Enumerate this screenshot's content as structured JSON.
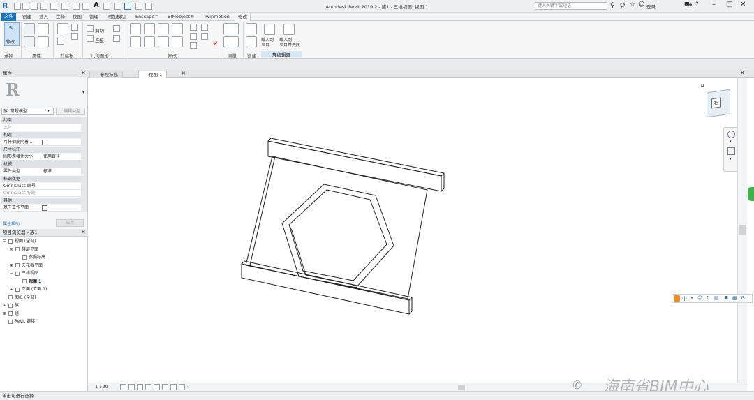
{
  "app": {
    "title": "Autodesk Revit 2019.2 - 族1 - 三维视图: 视图 1",
    "search_placeholder": "键入关键字或短语",
    "signin": "登录",
    "logo": "R"
  },
  "ribbon_tabs": [
    {
      "label": "文件",
      "kind": "file"
    },
    {
      "label": "创建"
    },
    {
      "label": "插入"
    },
    {
      "label": "注释"
    },
    {
      "label": "视图"
    },
    {
      "label": "管理"
    },
    {
      "label": "附加模块"
    },
    {
      "label": "Enscape™"
    },
    {
      "label": "BIMobject®"
    },
    {
      "label": "Twinmotion"
    },
    {
      "label": "修改",
      "active": true
    }
  ],
  "ribbon_groups": {
    "select": "选择",
    "modify_label": "修改",
    "properties": "属性",
    "clipboard": "剪贴板",
    "geometry": "几何图形",
    "modify": "修改",
    "measure": "测量",
    "create": "创建",
    "family_editor": "族编辑器",
    "cut": "剪切",
    "join": "连接",
    "load_into_project": "载入到\n项目",
    "load_into_project_close": "载入到\n项目并关闭"
  },
  "properties": {
    "header": "属性",
    "type_selector": "族: 常规模型",
    "edit_type": "编辑类型",
    "sections": {
      "constraints": "约束",
      "construction": "构造",
      "dimensions": "尺寸标注",
      "mechanical": "机械",
      "identity": "标识数据",
      "other": "其他"
    },
    "rows": {
      "host": {
        "k": "主体",
        "v": ""
      },
      "cut_with_voids": {
        "k": "可将钢筋附着...",
        "v": ""
      },
      "round_connector": {
        "k": "圆形连接件大小",
        "v": "使用直径"
      },
      "part_type": {
        "k": "零件类型",
        "v": "标准"
      },
      "omniclass_number": {
        "k": "OmniClass 编号",
        "v": ""
      },
      "omniclass_title": {
        "k": "OmniClass 标题",
        "v": ""
      },
      "workplane_based": {
        "k": "基于工作平面",
        "v": ""
      }
    },
    "help_link": "属性帮助",
    "apply": "应用"
  },
  "project_browser": {
    "header": "项目浏览器 - 族1",
    "items": [
      {
        "label": "视图 (全部)",
        "level": 0,
        "toggle": "⊟"
      },
      {
        "label": "楼层平面",
        "level": 1,
        "toggle": "⊟"
      },
      {
        "label": "参照标高",
        "level": 2,
        "toggle": ""
      },
      {
        "label": "天花板平面",
        "level": 1,
        "toggle": "⊞"
      },
      {
        "label": "三维视图",
        "level": 1,
        "toggle": "⊟"
      },
      {
        "label": "视图 1",
        "level": 2,
        "toggle": "",
        "bold": true
      },
      {
        "label": "立面 (立面 1)",
        "level": 1,
        "toggle": "⊞"
      },
      {
        "label": "图纸 (全部)",
        "level": 0,
        "toggle": ""
      },
      {
        "label": "族",
        "level": 0,
        "toggle": "⊞"
      },
      {
        "label": "组",
        "level": 0,
        "toggle": "⊞"
      },
      {
        "label": "Revit 链接",
        "level": 0,
        "toggle": ""
      }
    ]
  },
  "view_tabs": [
    {
      "label": "参照标高",
      "active": false
    },
    {
      "label": "视图 1",
      "active": true
    }
  ],
  "view_control": {
    "scale": "1 : 20"
  },
  "viewcube": {
    "face": "右",
    "face_top": "上"
  },
  "status": "单击可进行选择",
  "watermark": "海南省BIM中心",
  "ime": "中"
}
